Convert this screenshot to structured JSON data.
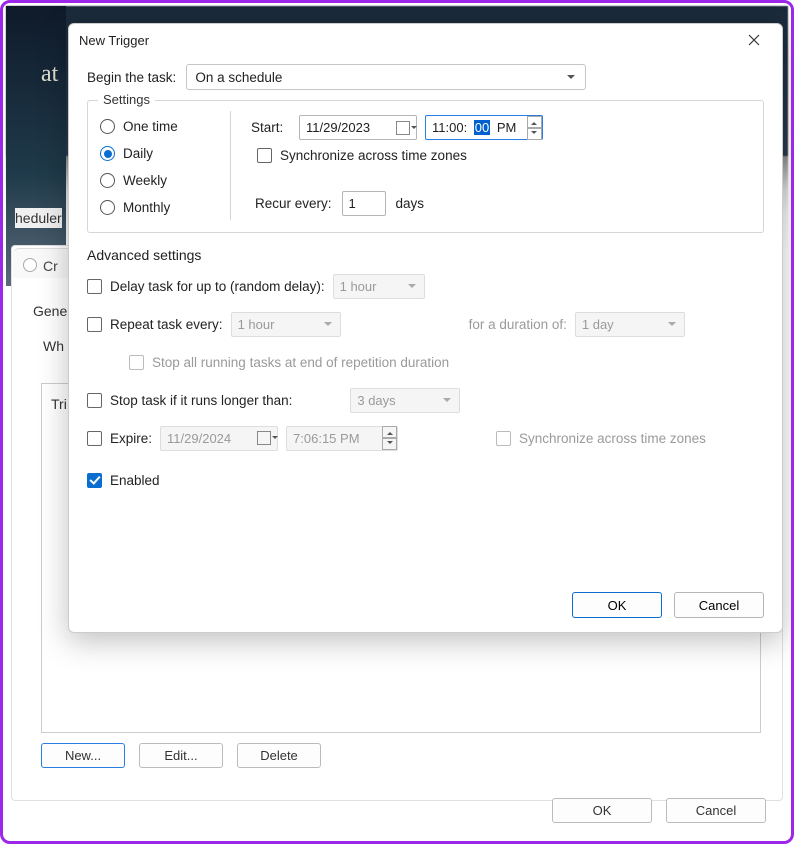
{
  "bg": {
    "at_text": "at",
    "scheduler_text": "heduler",
    "cr_text": "Cr",
    "gene_text": "Gene",
    "wh_text": "Wh",
    "tri_text": "Tri",
    "new_btn": "New...",
    "edit_btn": "Edit...",
    "delete_btn": "Delete",
    "ok_btn": "OK",
    "cancel_btn": "Cancel"
  },
  "dialog": {
    "title": "New Trigger",
    "begin_label": "Begin the task:",
    "begin_value": "On a schedule",
    "settings_legend": "Settings",
    "radios": {
      "onetime": "One time",
      "daily": "Daily",
      "weekly": "Weekly",
      "monthly": "Monthly"
    },
    "start_label": "Start:",
    "start_date": "11/29/2023",
    "start_time_h": "11:00:",
    "start_time_sel": "00",
    "start_time_ampm": " PM",
    "sync_tz_label": "Synchronize across time zones",
    "recur_label": "Recur every:",
    "recur_value": "1",
    "recur_unit": "days",
    "adv_heading": "Advanced settings",
    "delay_label": "Delay task for up to (random delay):",
    "delay_value": "1 hour",
    "repeat_label": "Repeat task every:",
    "repeat_value": "1 hour",
    "duration_label": "for a duration of:",
    "duration_value": "1 day",
    "stop_all_label": "Stop all running tasks at end of repetition duration",
    "stop_longer_label": "Stop task if it runs longer than:",
    "stop_longer_value": "3 days",
    "expire_label": "Expire:",
    "expire_date": "11/29/2024",
    "expire_time": "7:06:15 PM",
    "expire_sync_label": "Synchronize across time zones",
    "enabled_label": "Enabled",
    "ok_btn": "OK",
    "cancel_btn": "Cancel"
  }
}
